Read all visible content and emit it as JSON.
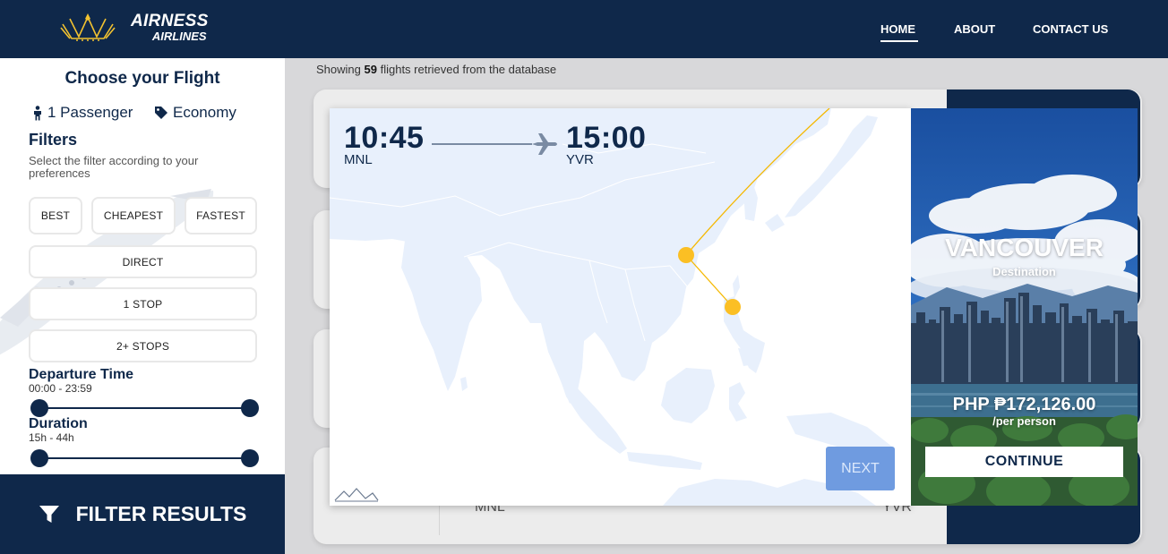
{
  "brand": {
    "line1": "AIRNESS",
    "line2": "AIRLINES"
  },
  "nav": {
    "home": "HOME",
    "about": "ABOUT",
    "contact": "CONTACT US"
  },
  "sidebar": {
    "title": "Choose your Flight",
    "passengers": "1 Passenger",
    "cabin": "Economy",
    "filters_title": "Filters",
    "filters_desc": "Select the filter according to your preferences",
    "buttons": {
      "best": "BEST",
      "cheapest": "CHEAPEST",
      "fastest": "FASTEST",
      "direct": "DIRECT",
      "one_stop": "1 STOP",
      "two_plus": "2+ STOPS"
    },
    "departure": {
      "label": "Departure Time",
      "range": "00:00 - 23:59"
    },
    "duration": {
      "label": "Duration",
      "range": "15h - 44h"
    },
    "filter_results": "FILTER RESULTS"
  },
  "results": {
    "showing_prefix": "Showing",
    "count": "59",
    "showing_suffix": "flights retrieved from the database",
    "bg_origin": "MNL",
    "bg_destination": "YVR"
  },
  "modal": {
    "departure_time": "10:45",
    "arrival_time": "15:00",
    "origin": "MNL",
    "destination": "YVR",
    "next_label": "NEXT",
    "dest_city": "VANCOUVER",
    "dest_sub": "Destination",
    "price": "PHP ₱172,126.00",
    "per_person": "/per person",
    "continue_label": "CONTINUE"
  },
  "colors": {
    "navy": "#0f284a",
    "accent": "#fbbf24",
    "next_button": "#6f9be0",
    "map_land": "#e8f0fc"
  },
  "icons": {
    "passenger": "person-icon",
    "cabin": "tag-icon",
    "filter": "funnel-icon",
    "route": "airplane-icon"
  }
}
